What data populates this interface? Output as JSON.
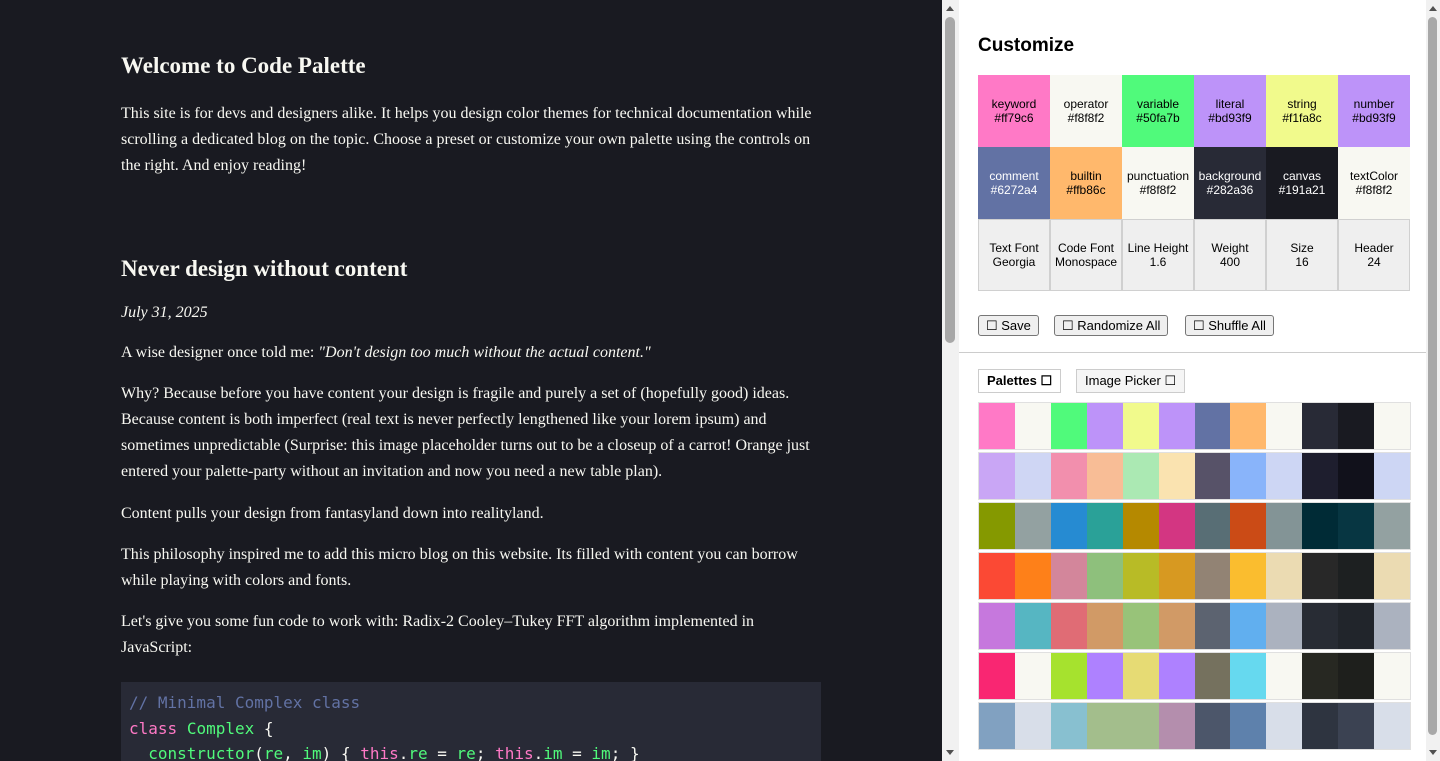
{
  "blog": {
    "welcome_title": "Welcome to Code Palette",
    "welcome_text": "This site is for devs and designers alike. It helps you design color themes for technical documentation while scrolling a dedicated blog on the topic. Choose a preset or customize your own palette using the controls on the right. And enjoy reading!",
    "post_title": "Never design without content",
    "post_date": "July 31, 2025",
    "p1_intro": "A wise designer once told me: ",
    "p1_quote": "\"Don't design too much without the actual content.\"",
    "p2": "Why? Because before you have content your design is fragile and purely a set of (hopefully good) ideas. Because content is both imperfect (real text is never perfectly lengthened like your lorem ipsum) and sometimes unpredictable (Surprise: this image placeholder turns out to be a closeup of a carrot! Orange just entered your palette-party without an invitation and now you need a new table plan).",
    "p3": "Content pulls your design from fantasyland down into realityland.",
    "p4": "This philosophy inspired me to add this micro blog on this website. Its filled with content you can borrow while playing with colors and fonts.",
    "p5": "Let's give you some fun code to work with: Radix-2 Cooley–Tukey FFT algorithm implemented in JavaScript:",
    "code": {
      "comment": "// Minimal Complex class",
      "kw_class": "class",
      "class_name": "Complex",
      "brace_open": " {",
      "ctor": "constructor",
      "p_open": "(",
      "arg_re": "re",
      "comma": ", ",
      "arg_im": "im",
      "ctor_rest": ") { ",
      "this1": "this",
      "dot_re": ".",
      "prop_re": "re",
      "eq1": " = ",
      "val_re": "re",
      "semi1": "; ",
      "this2": "this",
      "dot_im": ".",
      "prop_im": "im",
      "eq2": " = ",
      "val_im": "im",
      "semi2": "; }"
    }
  },
  "customize": {
    "title": "Customize",
    "colors": [
      {
        "name": "keyword",
        "value": "#ff79c6",
        "bg": "#ff79c6",
        "fg": "#000000"
      },
      {
        "name": "operator",
        "value": "#f8f8f2",
        "bg": "#f8f8f2",
        "fg": "#000000"
      },
      {
        "name": "variable",
        "value": "#50fa7b",
        "bg": "#50fa7b",
        "fg": "#000000"
      },
      {
        "name": "literal",
        "value": "#bd93f9",
        "bg": "#bd93f9",
        "fg": "#000000"
      },
      {
        "name": "string",
        "value": "#f1fa8c",
        "bg": "#f1fa8c",
        "fg": "#000000"
      },
      {
        "name": "number",
        "value": "#bd93f9",
        "bg": "#bd93f9",
        "fg": "#000000"
      },
      {
        "name": "comment",
        "value": "#6272a4",
        "bg": "#6272a4",
        "fg": "#ffffff"
      },
      {
        "name": "builtin",
        "value": "#ffb86c",
        "bg": "#ffb86c",
        "fg": "#000000"
      },
      {
        "name": "punctuation",
        "value": "#f8f8f2",
        "bg": "#f8f8f2",
        "fg": "#000000"
      },
      {
        "name": "background",
        "value": "#282a36",
        "bg": "#282a36",
        "fg": "#ffffff"
      },
      {
        "name": "canvas",
        "value": "#191a21",
        "bg": "#191a21",
        "fg": "#ffffff"
      },
      {
        "name": "textColor",
        "value": "#f8f8f2",
        "bg": "#f8f8f2",
        "fg": "#000000"
      }
    ],
    "settings": [
      {
        "name": "Text Font",
        "value": "Georgia"
      },
      {
        "name": "Code Font",
        "value": "Monospace"
      },
      {
        "name": "Line Height",
        "value": "1.6"
      },
      {
        "name": "Weight",
        "value": "400"
      },
      {
        "name": "Size",
        "value": "16"
      },
      {
        "name": "Header",
        "value": "24"
      }
    ],
    "buttons": {
      "save": "☐ Save",
      "randomize": "☐ Randomize All",
      "shuffle": "☐ Shuffle All"
    },
    "tabs": {
      "palettes": "Palettes ☐",
      "image_picker": "Image Picker ☐"
    },
    "palettes": [
      [
        "#ff79c6",
        "#f8f8f2",
        "#50fa7b",
        "#bd93f9",
        "#f1fa8c",
        "#bd93f9",
        "#6272a4",
        "#ffb86c",
        "#f8f8f2",
        "#282a36",
        "#191a21",
        "#f8f8f2"
      ],
      [
        "#c9a6f5",
        "#cfd6f4",
        "#f28fad",
        "#f8bd96",
        "#abe9b3",
        "#fae3b0",
        "#575268",
        "#89b4fa",
        "#cdd6f4",
        "#1e1e2e",
        "#11111b",
        "#cdd6f4"
      ],
      [
        "#859900",
        "#93a1a1",
        "#268bd2",
        "#2aa198",
        "#b58900",
        "#d33682",
        "#586e75",
        "#cb4b16",
        "#839496",
        "#002b36",
        "#073642",
        "#93a1a1"
      ],
      [
        "#fb4934",
        "#fe8019",
        "#d3869b",
        "#8ec07c",
        "#b8bb26",
        "#d79921",
        "#928374",
        "#fabd2f",
        "#ebdbb2",
        "#282828",
        "#1d2021",
        "#ebdbb2"
      ],
      [
        "#c678dd",
        "#56b6c2",
        "#e06c75",
        "#d19a66",
        "#98c379",
        "#d19a66",
        "#5c6370",
        "#61afef",
        "#abb2bf",
        "#282c34",
        "#21252b",
        "#abb2bf"
      ],
      [
        "#f92672",
        "#f8f8f2",
        "#a6e22e",
        "#ae81ff",
        "#e6db74",
        "#ae81ff",
        "#75715e",
        "#66d9ef",
        "#f8f8f2",
        "#272822",
        "#1e1f1c",
        "#f8f8f2"
      ],
      [
        "#81a1c1",
        "#d8dee9",
        "#88c0d0",
        "#a3be8c",
        "#a3be8c",
        "#b48ead",
        "#4c566a",
        "#5e81ac",
        "#d8dee9",
        "#2e3440",
        "#3b4252",
        "#d8dee9"
      ]
    ]
  }
}
